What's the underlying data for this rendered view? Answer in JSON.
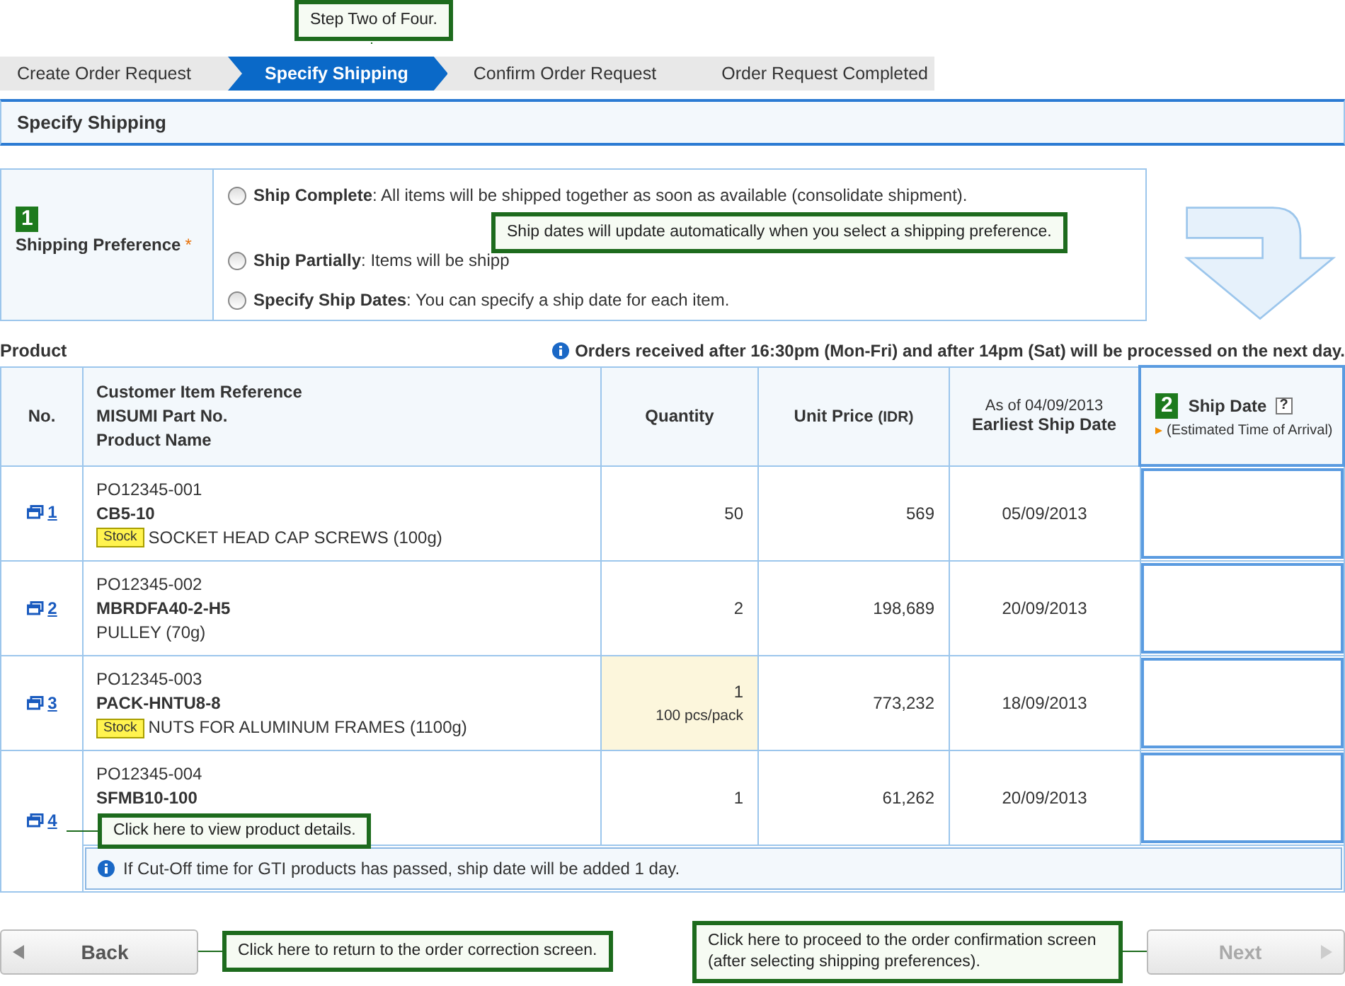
{
  "steps": {
    "callout": "Step Two of Four.",
    "items": [
      {
        "label": "Create Order Request",
        "selected": false
      },
      {
        "label": "Specify Shipping",
        "selected": true
      },
      {
        "label": "Confirm Order Request",
        "selected": false
      },
      {
        "label": "Order Request Completed",
        "selected": false
      }
    ]
  },
  "section_title": "Specify Shipping",
  "preference": {
    "number": "1",
    "label": "Shipping Preference",
    "required_mark": "*",
    "callout": "Ship dates will update automatically when you select a shipping preference.",
    "options": [
      {
        "title": "Ship Complete",
        "text": ": All items will be shipped together as soon as available (consolidate shipment).",
        "selected": false
      },
      {
        "title": "Ship Partially",
        "text": ": Items will be shipp",
        "selected": false
      },
      {
        "title": "Specify Ship Dates",
        "text": ": You can specify a ship date for each item.",
        "selected": false
      }
    ]
  },
  "product_heading": "Product",
  "notice": "Orders received after 16:30pm (Mon-Fri) and after 14pm (Sat) will be processed on the next day.",
  "table": {
    "columns": {
      "no": "No.",
      "reference": [
        "Customer Item Reference",
        "MISUMI Part No.",
        "Product Name"
      ],
      "quantity": "Quantity",
      "price": "Unit Price",
      "price_unit": "(IDR)",
      "as_of": "As of 04/09/2013",
      "earliest": "Earliest Ship Date",
      "ship_number": "2",
      "ship_date": "Ship Date",
      "help": "?",
      "eta": "(Estimated Time of Arrival)"
    },
    "rows": [
      {
        "no": "1",
        "reference": "PO12345-001",
        "part": "CB5-10",
        "stock": true,
        "stock_label": "Stock",
        "name": "SOCKET HEAD CAP SCREWS (100g)",
        "quantity": "50",
        "highlighted": false,
        "price": "569",
        "earliest": "05/09/2013"
      },
      {
        "no": "2",
        "reference": "PO12345-002",
        "part": "MBRDFA40-2-H5",
        "stock": false,
        "name": "PULLEY (70g)",
        "quantity": "2",
        "highlighted": false,
        "price": "198,689",
        "earliest": "20/09/2013"
      },
      {
        "no": "3",
        "reference": "PO12345-003",
        "part": "PACK-HNTU8-8",
        "stock": true,
        "stock_label": "Stock",
        "name": "NUTS FOR ALUMINUM FRAMES (1100g)",
        "quantity": "1",
        "pack": "100 pcs/pack",
        "highlighted": true,
        "price": "773,232",
        "earliest": "18/09/2013"
      },
      {
        "no": "4",
        "reference": "PO12345-004",
        "part": "SFMB10-100",
        "stock": false,
        "quantity": "1",
        "highlighted": false,
        "price": "61,262",
        "earliest": "20/09/2013",
        "callout": "Click here to view product details."
      }
    ],
    "note": "If Cut-Off time for GTI products has passed, ship date will be added 1 day."
  },
  "back": {
    "label": "Back",
    "disabled": false,
    "callout": "Click here to return to the order correction screen."
  },
  "next": {
    "label": "Next",
    "disabled": true,
    "callout": "Click here to proceed to the order confirmation screen (after selecting shipping preferences)."
  }
}
